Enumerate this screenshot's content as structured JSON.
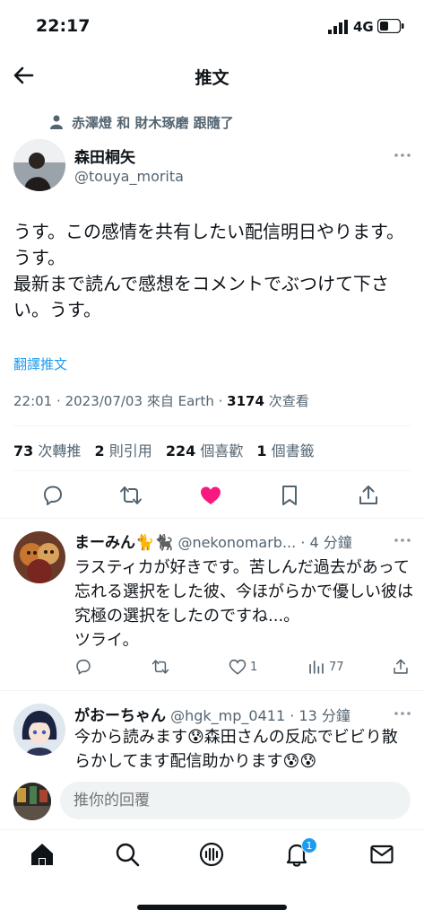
{
  "status_bar": {
    "time": "22:17",
    "network": "4G",
    "icons": [
      "signal-icon",
      "battery-icon"
    ]
  },
  "header": {
    "title": "推文",
    "back_icon": "arrow-left-icon"
  },
  "social_context": {
    "text": "赤澤燈 和 財木琢磨 跟隨了",
    "icon": "person-icon"
  },
  "tweet": {
    "author_name": "森田桐矢",
    "author_handle": "@touya_morita",
    "text": "うす。この感情を共有したい配信明日やります。うす。\n最新まで読んで感想をコメントでぶつけて下さい。うす。",
    "translate_label": "翻譯推文",
    "meta": {
      "time": "22:01",
      "date": "2023/07/03",
      "source_prefix": "來自",
      "source": "Earth",
      "views_count": "3174",
      "views_label": "次查看"
    },
    "stats": {
      "retweets_count": "73",
      "retweets_label": "次轉推",
      "quotes_count": "2",
      "quotes_label": "則引用",
      "likes_count": "224",
      "likes_label": "個喜歡",
      "bookmarks_count": "1",
      "bookmarks_label": "個書籤"
    },
    "actions": [
      "reply-icon",
      "retweet-icon",
      "like-icon",
      "bookmark-icon",
      "share-icon"
    ],
    "liked": true,
    "like_color": "#f91880"
  },
  "replies": [
    {
      "name": "まーみん🐈🐈‍⬛",
      "handle": "@nekonomarb...",
      "time": "4 分鐘",
      "text": "ラスティカが好きです。苦しんだ過去があって忘れる選択をした彼、今ほがらかで優しい彼は究極の選択をしたのですね...。\nツライ。",
      "likes": "1",
      "views": "77"
    },
    {
      "name": "がおーちゃん",
      "handle": "@hgk_mp_0411",
      "time": "13 分鐘",
      "text": "今から読みます😰森田さんの反応でビビり散らかしてます配信助かります😰😰",
      "likes": "",
      "views": ""
    }
  ],
  "composer": {
    "placeholder": "推你的回覆"
  },
  "tabbar": {
    "tabs": [
      "home-icon",
      "search-icon",
      "spaces-icon",
      "notifications-icon",
      "messages-icon"
    ],
    "notifications_badge": "1"
  },
  "colors": {
    "accent": "#1d9bf0",
    "text": "#0f1419",
    "secondary": "#536471",
    "like": "#f91880"
  }
}
